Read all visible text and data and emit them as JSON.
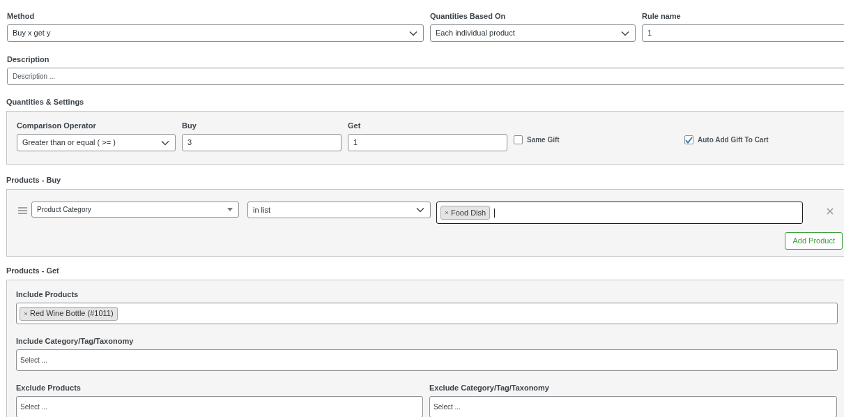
{
  "top_fields": [
    {
      "label": "Method",
      "kind": "select",
      "value": "Buy x get y"
    },
    {
      "label": "Quantities Based On",
      "kind": "select",
      "value": "Each individual product"
    },
    {
      "label": "Rule name",
      "kind": "input",
      "value": "1"
    }
  ],
  "description": {
    "label": "Description",
    "placeholder": "Description ..."
  },
  "quantities": {
    "title": "Quantities & Settings",
    "fields": [
      {
        "label": "Comparison Operator",
        "kind": "select",
        "value": "Greater than or equal ( >= )"
      },
      {
        "label": "Buy",
        "kind": "input",
        "value": "3"
      },
      {
        "label": "Get",
        "kind": "input",
        "value": "1"
      }
    ],
    "checkboxes": [
      {
        "label": "Same Gift",
        "checked": false
      },
      {
        "label": "Auto Add Gift To Cart",
        "checked": true
      }
    ]
  },
  "products_buy": {
    "title": "Products - Buy",
    "rows": [
      {
        "type": "Product Category",
        "operator": "in list",
        "focused": true,
        "tags": [
          "Food Dish"
        ]
      }
    ],
    "add_button": "Add Product"
  },
  "products_get": {
    "title": "Products - Get",
    "include_products": {
      "label": "Include Products",
      "tags": [
        "Red Wine Bottle (#1011)"
      ]
    },
    "include_category": {
      "label": "Include Category/Tag/Taxonomy",
      "placeholder": "Select ..."
    },
    "exclude_products": {
      "label": "Exclude Products",
      "placeholder": "Select ..."
    },
    "exclude_category": {
      "label": "Exclude Category/Tag/Taxonomy",
      "placeholder": "Select ..."
    }
  }
}
